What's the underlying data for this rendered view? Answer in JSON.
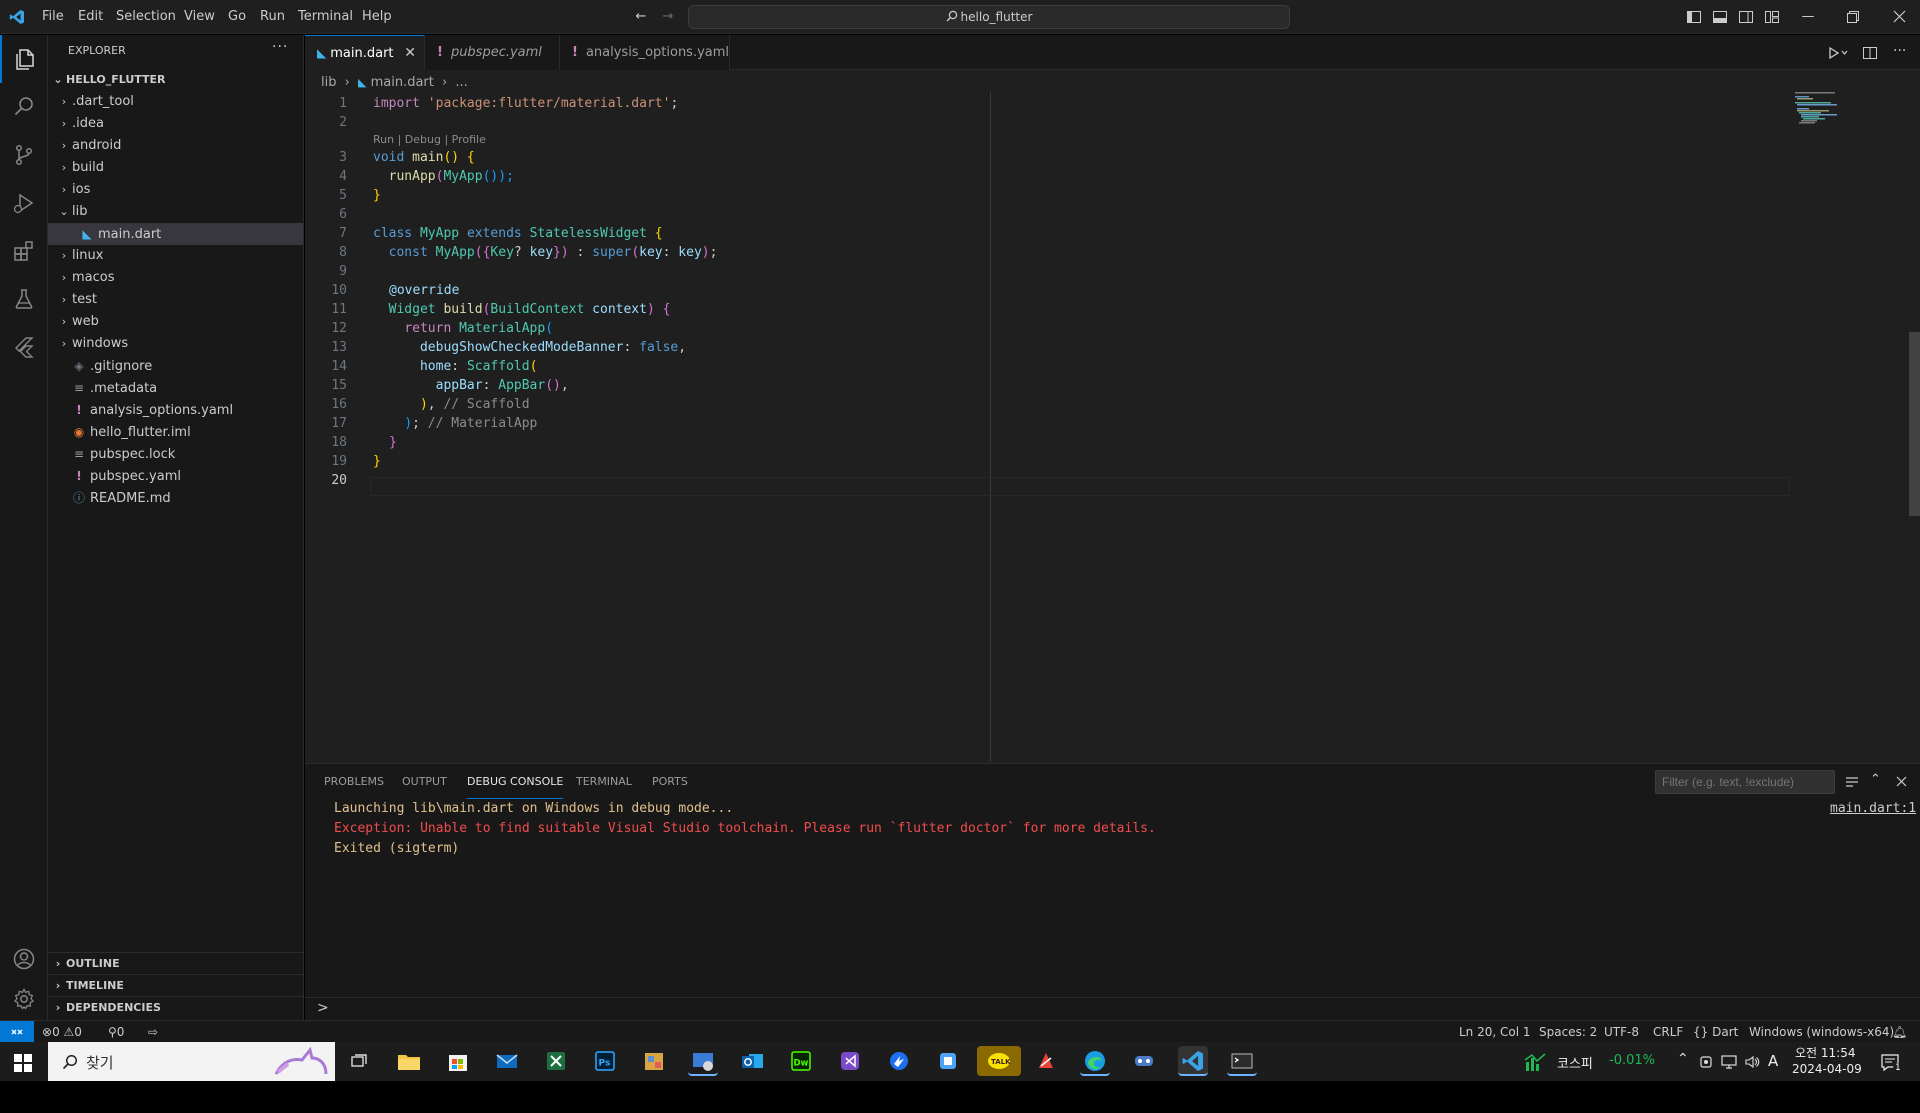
{
  "menu": [
    "File",
    "Edit",
    "Selection",
    "View",
    "Go",
    "Run",
    "Terminal",
    "Help"
  ],
  "search": {
    "text": "hello_flutter"
  },
  "sidebar": {
    "title": "EXPLORER",
    "root": "HELLO_FLUTTER",
    "items": [
      {
        "label": ".dart_tool",
        "type": "folder",
        "depth": 0
      },
      {
        "label": ".idea",
        "type": "folder",
        "depth": 0
      },
      {
        "label": "android",
        "type": "folder",
        "depth": 0
      },
      {
        "label": "build",
        "type": "folder",
        "depth": 0
      },
      {
        "label": "ios",
        "type": "folder",
        "depth": 0
      },
      {
        "label": "lib",
        "type": "folder-open",
        "depth": 0
      },
      {
        "label": "main.dart",
        "type": "dart",
        "depth": 1
      },
      {
        "label": "linux",
        "type": "folder",
        "depth": 0
      },
      {
        "label": "macos",
        "type": "folder",
        "depth": 0
      },
      {
        "label": "test",
        "type": "folder",
        "depth": 0
      },
      {
        "label": "web",
        "type": "folder",
        "depth": 0
      },
      {
        "label": "windows",
        "type": "folder",
        "depth": 0
      },
      {
        "label": ".gitignore",
        "type": "git",
        "depth": 0
      },
      {
        "label": ".metadata",
        "type": "lines",
        "depth": 0
      },
      {
        "label": "analysis_options.yaml",
        "type": "yaml",
        "depth": 0
      },
      {
        "label": "hello_flutter.iml",
        "type": "rss",
        "depth": 0
      },
      {
        "label": "pubspec.lock",
        "type": "lines",
        "depth": 0
      },
      {
        "label": "pubspec.yaml",
        "type": "yaml",
        "depth": 0
      },
      {
        "label": "README.md",
        "type": "info",
        "depth": 0
      }
    ],
    "sections": [
      "OUTLINE",
      "TIMELINE",
      "DEPENDENCIES"
    ]
  },
  "tabs": [
    {
      "label": "main.dart",
      "icon": "dart",
      "active": true
    },
    {
      "label": "pubspec.yaml",
      "icon": "yaml",
      "active": false
    },
    {
      "label": "analysis_options.yaml",
      "icon": "yaml",
      "active": false
    }
  ],
  "breadcrumb": {
    "folder": "lib",
    "file": "main.dart",
    "more": "..."
  },
  "code_lens": "Run | Debug | Profile",
  "line_numbers": [
    "1",
    "2",
    "3",
    "4",
    "5",
    "6",
    "7",
    "8",
    "9",
    "10",
    "11",
    "12",
    "13",
    "14",
    "15",
    "16",
    "17",
    "18",
    "19",
    "20"
  ],
  "code": {
    "l1_kw": "import",
    "l1_str": "'package:flutter/material.dart'",
    "l1_end": ";",
    "l3_type": "void",
    "l3_fn": "main",
    "l3_rest": "() {",
    "l4_fn": "runApp",
    "l4_cls": "MyApp",
    "l4_rest": "());",
    "l5": "}",
    "l7_kw": "class",
    "l7_cls": "MyApp",
    "l7_kw2": "extends",
    "l7_cls2": "StatelessWidget",
    "l7_br": "{",
    "l8_kw": "const",
    "l8_cls": "MyApp",
    "l8_type": "Key",
    "l8_q": "?",
    "l8_param": "key",
    "l8_colon": " : ",
    "l8_super": "super",
    "l8_named": "key",
    "l8_val": "key",
    "l8_end": ";",
    "l10": "@override",
    "l11_type": "Widget",
    "l11_fn": "build",
    "l11_ptype": "BuildContext",
    "l11_param": "context",
    "l11_br": "{",
    "l12_kw": "return",
    "l12_cls": "MaterialApp",
    "l13_prop": "debugShowCheckedModeBanner",
    "l13_val": "false",
    "l14_prop": "home",
    "l14_cls": "Scaffold",
    "l15_prop": "appBar",
    "l15_cls": "AppBar",
    "l16_comment": "// Scaffold",
    "l17_comment": "// MaterialApp",
    "l18": "}",
    "l19": "}"
  },
  "panel": {
    "tabs": [
      "PROBLEMS",
      "OUTPUT",
      "DEBUG CONSOLE",
      "TERMINAL",
      "PORTS"
    ],
    "active_tab": "DEBUG CONSOLE",
    "filter_placeholder": "Filter (e.g. text, !exclude)",
    "lines": [
      {
        "text": "Launching lib\\main.dart on Windows in debug mode...",
        "color": "#e2c08d"
      },
      {
        "text": "Exception: Unable to find suitable Visual Studio toolchain. Please run `flutter doctor` for more details.",
        "color": "#f14c4c"
      },
      {
        "text": "Exited (sigterm)",
        "color": "#e2c08d"
      }
    ],
    "source_link": "main.dart:1",
    "prompt": ">"
  },
  "status": {
    "errors": "0",
    "warnings": "0",
    "ports": "0",
    "position": "Ln 20, Col 1",
    "spaces": "Spaces: 2",
    "encoding": "UTF-8",
    "eol": "CRLF",
    "language": "Dart",
    "device": "Windows (windows-x64)"
  },
  "taskbar": {
    "search_placeholder": "찾기",
    "stock_name": "코스피",
    "stock_change": "-0.01%",
    "time": "오전 11:54",
    "date": "2024-04-09",
    "ime": "A",
    "notif_count": "1"
  },
  "colors": {
    "accent": "#0078d4",
    "editor_bg": "#1f1f1f",
    "sidebar_bg": "#181818",
    "remote": "#0078d4"
  }
}
